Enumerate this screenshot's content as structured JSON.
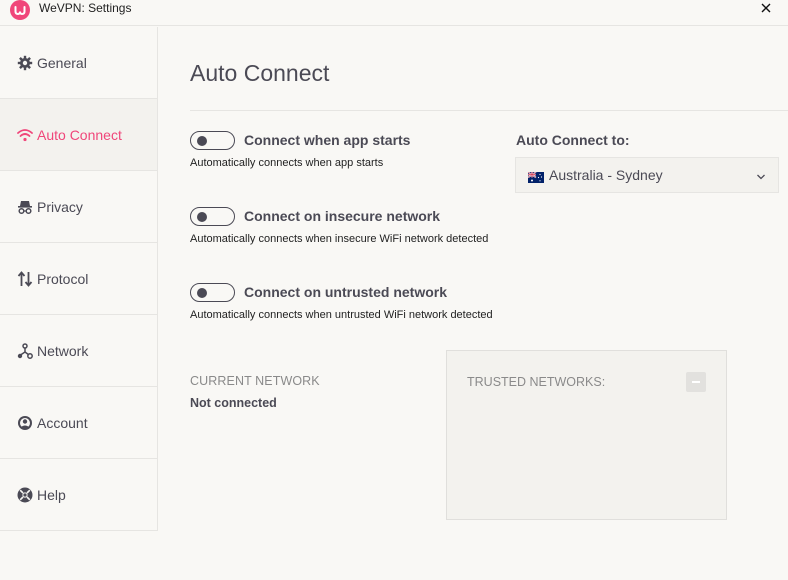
{
  "window": {
    "title": "WeVPN: Settings",
    "logo_letter": "w",
    "brand_color": "#f0467a"
  },
  "sidebar": {
    "items": [
      {
        "label": "General",
        "icon": "gear-icon",
        "active": false
      },
      {
        "label": "Auto Connect",
        "icon": "wifi-icon",
        "active": true
      },
      {
        "label": "Privacy",
        "icon": "incognito-icon",
        "active": false
      },
      {
        "label": "Protocol",
        "icon": "arrows-up-down-icon",
        "active": false
      },
      {
        "label": "Network",
        "icon": "network-icon",
        "active": false
      },
      {
        "label": "Account",
        "icon": "account-icon",
        "active": false
      },
      {
        "label": "Help",
        "icon": "lifebuoy-icon",
        "active": false
      }
    ]
  },
  "main": {
    "title": "Auto Connect",
    "settings": [
      {
        "label": "Connect when app starts",
        "description": "Automatically connects when app starts",
        "enabled": false
      },
      {
        "label": "Connect on insecure network",
        "description": "Automatically connects when insecure WiFi network detected",
        "enabled": false
      },
      {
        "label": "Connect on untrusted network",
        "description": "Automatically connects when untrusted WiFi network detected",
        "enabled": false
      }
    ],
    "auto_connect_to": {
      "label": "Auto Connect to:",
      "selected": "Australia - Sydney",
      "flag": "australia-flag-icon"
    },
    "current_network": {
      "label": "CURRENT NETWORK",
      "value": "Not connected"
    },
    "trusted_networks": {
      "label": "TRUSTED NETWORKS:",
      "items": []
    }
  }
}
